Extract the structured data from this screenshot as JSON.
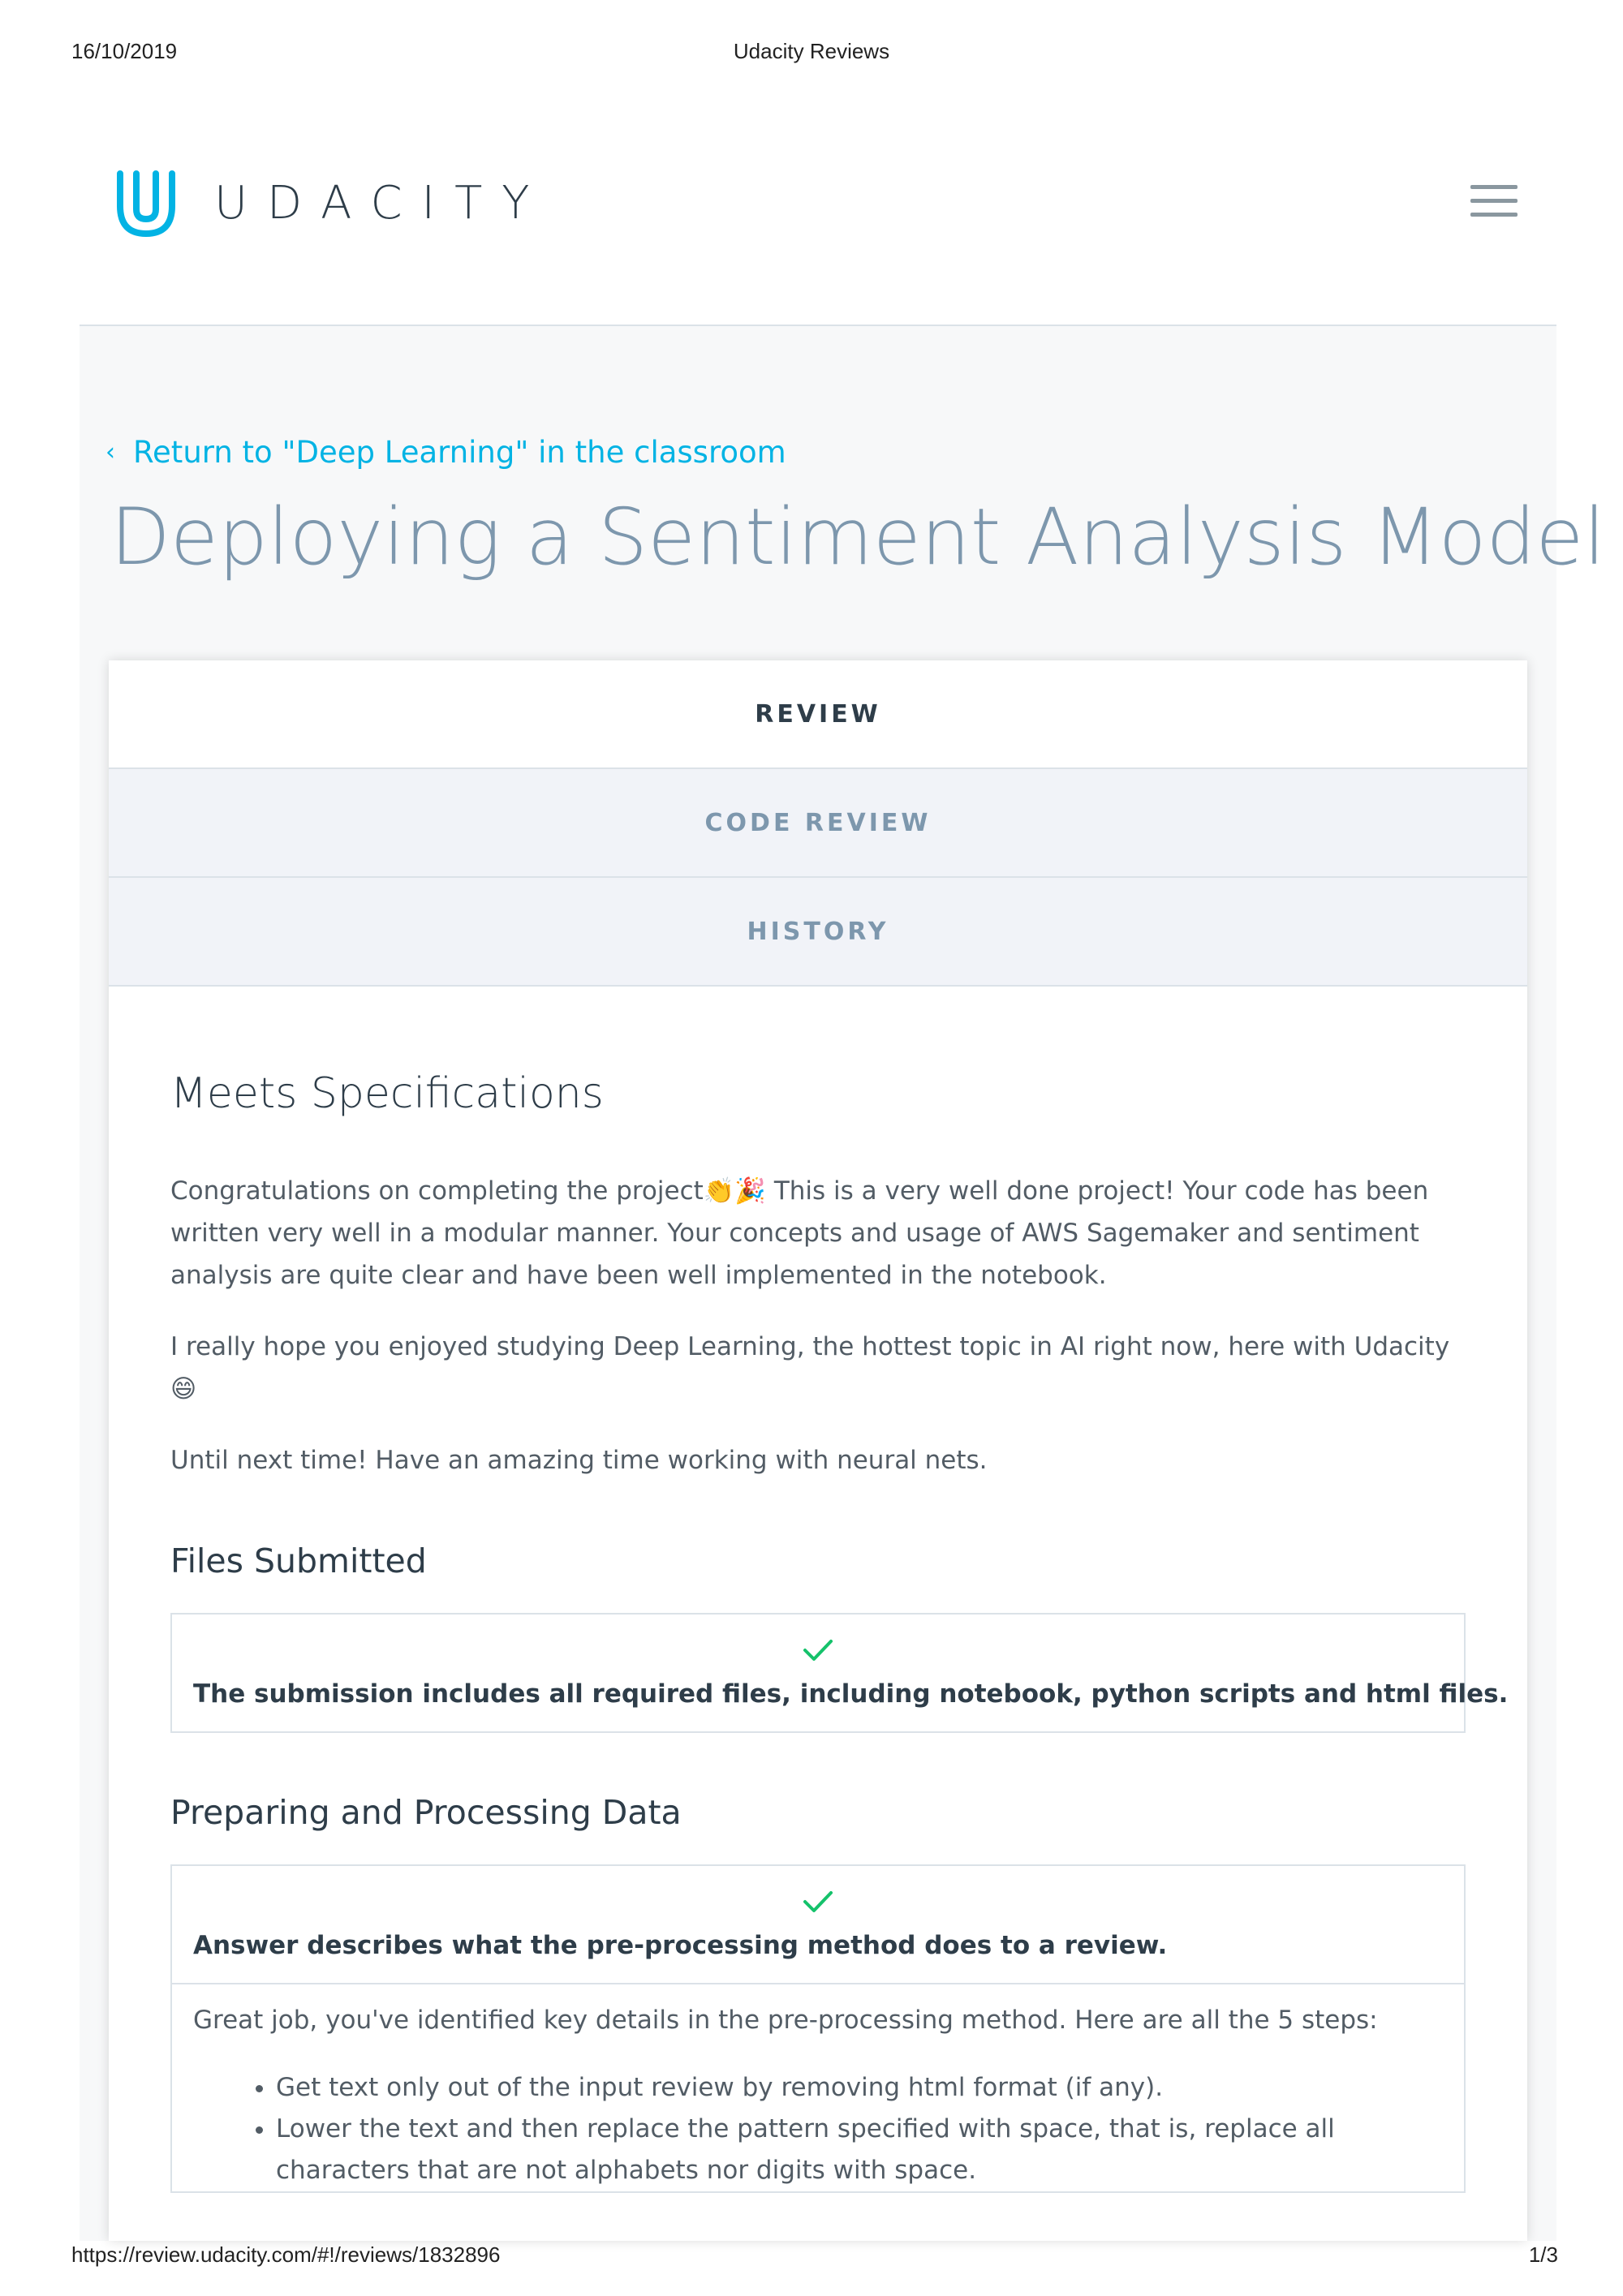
{
  "print_header": {
    "date": "16/10/2019",
    "title": "Udacity Reviews"
  },
  "print_footer": {
    "url": "https://review.udacity.com/#!/reviews/1832896",
    "page": "1/3"
  },
  "brand": {
    "name": "UDACITY",
    "color": "#02b3e4"
  },
  "nav": {
    "back_link": "Return to \"Deep Learning\" in the classroom"
  },
  "page_title": "Deploying a Sentiment Analysis Model",
  "tabs": [
    {
      "label": "REVIEW",
      "active": true
    },
    {
      "label": "CODE REVIEW",
      "active": false
    },
    {
      "label": "HISTORY",
      "active": false
    }
  ],
  "review": {
    "status": "Meets Specifications",
    "paragraphs": [
      "Congratulations on completing the project👏🎉 This is a very well done project! Your code has been written very well in a modular manner. Your concepts and usage of AWS Sagemaker and sentiment analysis are quite clear and have been well implemented in the notebook.",
      "I really hope you enjoyed studying Deep Learning, the hottest topic in AI right now, here with Udacity 😄",
      "Until next time! Have an amazing time working with neural nets."
    ]
  },
  "sections": [
    {
      "title": "Files Submitted",
      "criterion": "The submission includes all required files, including notebook, python scripts and html files."
    },
    {
      "title": "Preparing and Processing Data",
      "criterion": "Answer describes what the pre-processing method does to a review.",
      "note": "Great job, you've identified key details in the pre-processing method. Here are all the 5 steps:",
      "steps": [
        "Get text only out of the input review by removing html format (if any).",
        "Lower the text and then replace the pattern specified with space, that is, replace all characters that are not alphabets nor digits with space."
      ]
    }
  ],
  "colors": {
    "check": "#15c26b",
    "title": "#7d97ad",
    "link": "#02b3e4"
  }
}
